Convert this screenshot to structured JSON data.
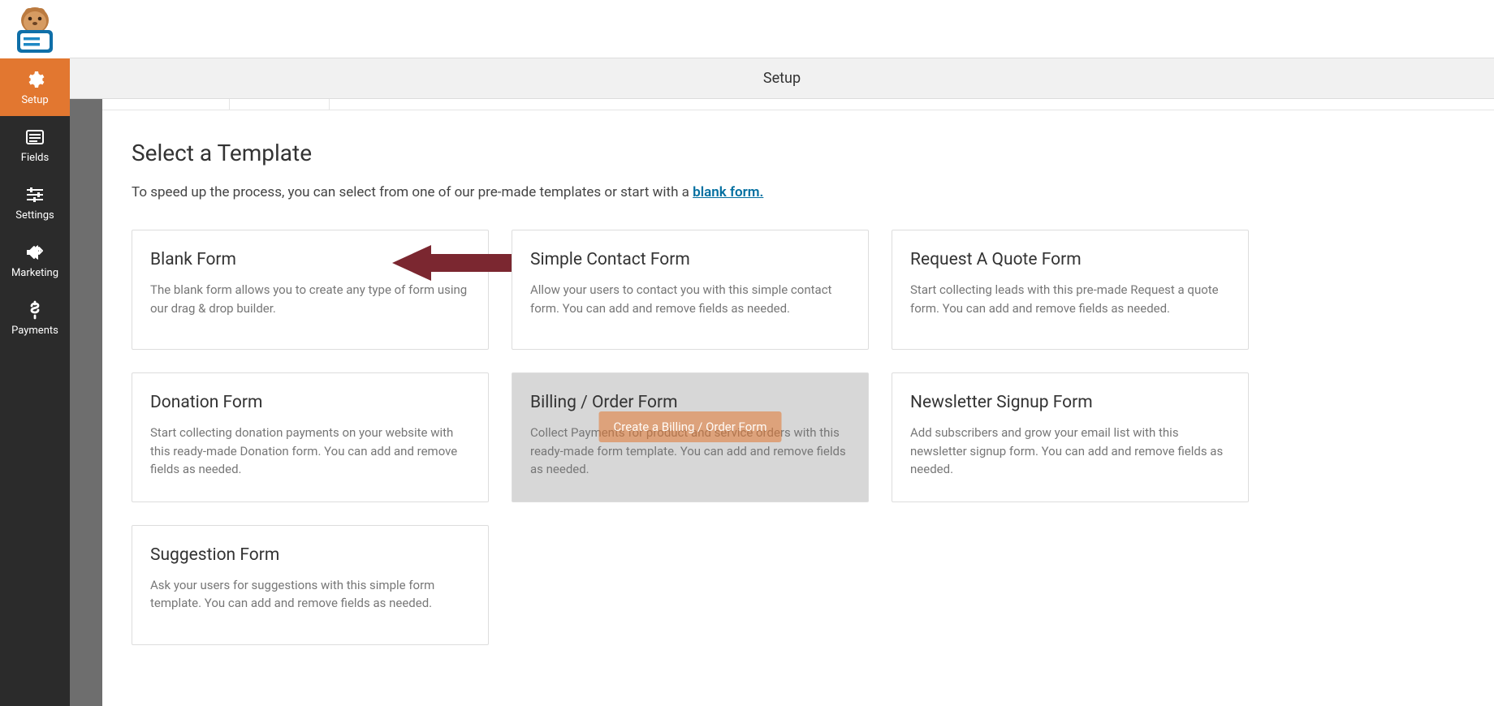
{
  "sidebar": {
    "items": [
      {
        "label": "Setup",
        "icon": "gear",
        "active": true
      },
      {
        "label": "Fields",
        "icon": "list",
        "active": false
      },
      {
        "label": "Settings",
        "icon": "sliders",
        "active": false
      },
      {
        "label": "Marketing",
        "icon": "bullhorn",
        "active": false
      },
      {
        "label": "Payments",
        "icon": "dollar",
        "active": false
      }
    ]
  },
  "header": {
    "section_title": "Setup"
  },
  "page": {
    "title": "Select a Template",
    "subtitle_prefix": "To speed up the process, you can select from one of our pre-made templates or start with a ",
    "subtitle_link": "blank form."
  },
  "templates": [
    {
      "title": "Blank Form",
      "desc": "The blank form allows you to create any type of form using our drag & drop builder.",
      "arrow": true
    },
    {
      "title": "Simple Contact Form",
      "desc": "Allow your users to contact you with this simple contact form. You can add and remove fields as needed."
    },
    {
      "title": "Request A Quote Form",
      "desc": "Start collecting leads with this pre-made Request a quote form. You can add and remove fields as needed."
    },
    {
      "title": "Donation Form",
      "desc": "Start collecting donation payments on your website with this ready-made Donation form. You can add and remove fields as needed."
    },
    {
      "title": "Billing / Order Form",
      "desc": "Collect Payments for product and service orders with this ready-made form template. You can add and remove fields as needed.",
      "hover": true,
      "hover_label": "Create a Billing / Order Form"
    },
    {
      "title": "Newsletter Signup Form",
      "desc": "Add subscribers and grow your email list with this newsletter signup form. You can add and remove fields as needed."
    },
    {
      "title": "Suggestion Form",
      "desc": "Ask your users for suggestions with this simple form template. You can add and remove fields as needed."
    }
  ]
}
